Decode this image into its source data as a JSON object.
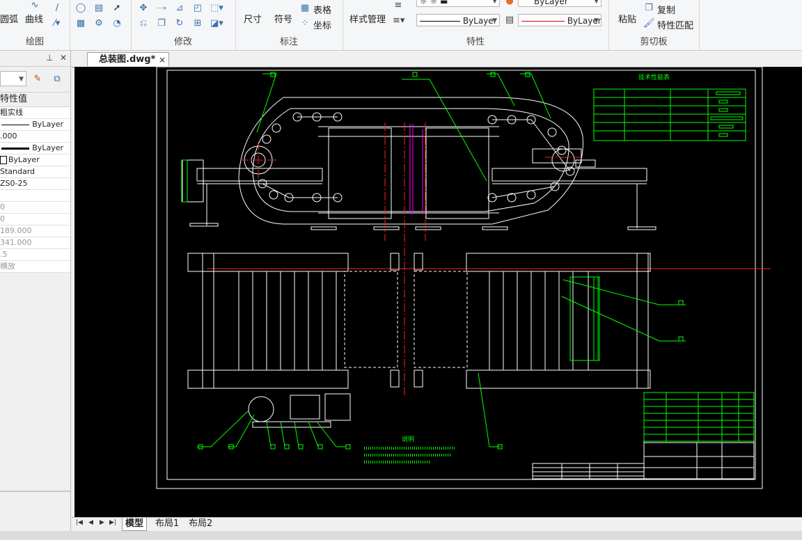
{
  "ribbon": {
    "groups": [
      {
        "label": "绘图",
        "buttons": [
          "圆弧",
          "曲线"
        ]
      },
      {
        "label": "修改"
      },
      {
        "label": "标注",
        "buttons": [
          "尺寸",
          "符号",
          "表格",
          "坐标"
        ]
      },
      {
        "label": "特性",
        "buttons": [
          "样式管理"
        ],
        "layer_combo": "ByLayer",
        "linetype_combo": "ByLayer",
        "lineweight_combo": "ByLayer"
      },
      {
        "label": "剪切板",
        "buttons": [
          "粘贴",
          "复制",
          "特性匹配"
        ]
      }
    ]
  },
  "properties_palette": {
    "section_title": "特性值",
    "rows": [
      {
        "value": "粗实线",
        "style": "normal"
      },
      {
        "value": "ByLayer",
        "style": "normal",
        "line": "thin"
      },
      {
        "value": ".000",
        "style": "normal"
      },
      {
        "value": "ByLayer",
        "style": "normal",
        "line": "thick"
      },
      {
        "value": "ByLayer",
        "style": "normal",
        "checkbox": true
      },
      {
        "value": "Standard",
        "style": "normal"
      },
      {
        "value": "ZS0-25",
        "style": "normal"
      },
      {
        "value": "",
        "style": "grey"
      },
      {
        "value": "0",
        "style": "grey"
      },
      {
        "value": "0",
        "style": "grey"
      },
      {
        "value": "189.000",
        "style": "grey"
      },
      {
        "value": "341.000",
        "style": "grey"
      },
      {
        "value": ".5",
        "style": "grey"
      },
      {
        "value": "横放",
        "style": "grey"
      }
    ],
    "pin_icon": "pin-icon",
    "close_icon": "close-icon"
  },
  "document": {
    "tab_label": "总装图.dwg*",
    "close": "×"
  },
  "drawing": {
    "tech_req_title": "技术性能表",
    "notes_title": "说明"
  },
  "layout_tabs": [
    "模型",
    "布局1",
    "布局2"
  ],
  "colors": {
    "canvas": "#000000",
    "geometry": "#ffffff",
    "leader": "#00ff00",
    "centerline": "#ff2020",
    "hidden": "#ff00ff"
  }
}
